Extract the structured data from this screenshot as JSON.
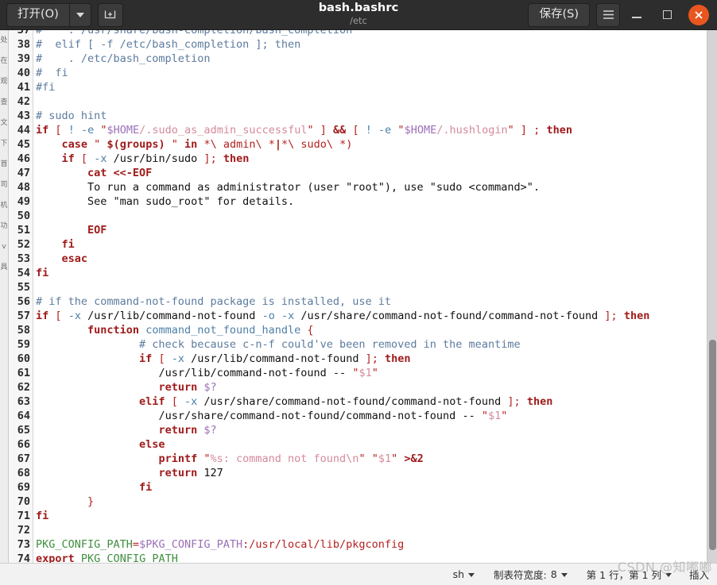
{
  "window": {
    "title": "bash.bashrc",
    "subtitle": "/etc",
    "open_button": "打开(O)",
    "open_dropdown_icon": "chevron-down-icon",
    "new_document_icon": "new-document-icon",
    "save_button": "保存(S)",
    "menu_icon": "hamburger-menu-icon",
    "minimize_icon": "minimize-icon",
    "maximize_icon": "maximize-icon",
    "close_icon": "close-icon",
    "titlebar_bg": "#2d2d2d",
    "close_color": "#e8561f"
  },
  "editor": {
    "first_visible_line": 37,
    "last_visible_line": 74,
    "background_sliver_chars": [
      "处",
      "在",
      "观",
      "查",
      "文",
      "下",
      "首",
      "司",
      "机",
      "功",
      "v",
      "具"
    ],
    "lines": [
      {
        "n": 37,
        "tokens": [
          {
            "t": "#    . /usr/share/bash-completion/bash_completion",
            "c": "c"
          }
        ]
      },
      {
        "n": 38,
        "tokens": [
          {
            "t": "#  elif [ -f /etc/bash_completion ]; then",
            "c": "c"
          }
        ]
      },
      {
        "n": 39,
        "tokens": [
          {
            "t": "#    . /etc/bash_completion",
            "c": "c"
          }
        ]
      },
      {
        "n": 40,
        "tokens": [
          {
            "t": "#  fi",
            "c": "c"
          }
        ]
      },
      {
        "n": 41,
        "tokens": [
          {
            "t": "#fi",
            "c": "c"
          }
        ]
      },
      {
        "n": 42,
        "tokens": []
      },
      {
        "n": 43,
        "tokens": [
          {
            "t": "# sudo hint",
            "c": "c"
          }
        ]
      },
      {
        "n": 44,
        "tokens": [
          {
            "t": "if",
            "c": "kw"
          },
          {
            "t": " ",
            "c": "pl"
          },
          {
            "t": "[",
            "c": "op"
          },
          {
            "t": " ",
            "c": "pl"
          },
          {
            "t": "!",
            "c": "fl"
          },
          {
            "t": " ",
            "c": "pl"
          },
          {
            "t": "-e",
            "c": "fl"
          },
          {
            "t": " ",
            "c": "pl"
          },
          {
            "t": "\"",
            "c": "sq"
          },
          {
            "t": "$HOME",
            "c": "vr"
          },
          {
            "t": "/.sudo_as_admin_successful",
            "c": "st"
          },
          {
            "t": "\"",
            "c": "sq"
          },
          {
            "t": " ",
            "c": "pl"
          },
          {
            "t": "]",
            "c": "op"
          },
          {
            "t": " ",
            "c": "pl"
          },
          {
            "t": "&&",
            "c": "kw"
          },
          {
            "t": " ",
            "c": "pl"
          },
          {
            "t": "[",
            "c": "op"
          },
          {
            "t": " ",
            "c": "pl"
          },
          {
            "t": "!",
            "c": "fl"
          },
          {
            "t": " ",
            "c": "pl"
          },
          {
            "t": "-e",
            "c": "fl"
          },
          {
            "t": " ",
            "c": "pl"
          },
          {
            "t": "\"",
            "c": "sq"
          },
          {
            "t": "$HOME",
            "c": "vr"
          },
          {
            "t": "/.hushlogin",
            "c": "st"
          },
          {
            "t": "\"",
            "c": "sq"
          },
          {
            "t": " ",
            "c": "pl"
          },
          {
            "t": "]",
            "c": "op"
          },
          {
            "t": " ",
            "c": "pl"
          },
          {
            "t": ";",
            "c": "op"
          },
          {
            "t": " ",
            "c": "pl"
          },
          {
            "t": "then",
            "c": "kw"
          }
        ]
      },
      {
        "n": 45,
        "tokens": [
          {
            "t": "    ",
            "c": "pl"
          },
          {
            "t": "case",
            "c": "kw"
          },
          {
            "t": " ",
            "c": "pl"
          },
          {
            "t": "\"",
            "c": "sq"
          },
          {
            "t": " ",
            "c": "st"
          },
          {
            "t": "$(groups)",
            "c": "kw"
          },
          {
            "t": " ",
            "c": "st"
          },
          {
            "t": "\"",
            "c": "sq"
          },
          {
            "t": " ",
            "c": "pl"
          },
          {
            "t": "in",
            "c": "kw"
          },
          {
            "t": " ",
            "c": "pl"
          },
          {
            "t": "*\\ admin\\ *",
            "c": "op"
          },
          {
            "t": "|",
            "c": "kw"
          },
          {
            "t": "*\\ sudo\\ *)",
            "c": "op"
          }
        ]
      },
      {
        "n": 46,
        "tokens": [
          {
            "t": "    ",
            "c": "pl"
          },
          {
            "t": "if",
            "c": "kw"
          },
          {
            "t": " ",
            "c": "pl"
          },
          {
            "t": "[",
            "c": "op"
          },
          {
            "t": " ",
            "c": "pl"
          },
          {
            "t": "-x",
            "c": "fl"
          },
          {
            "t": " ",
            "c": "pl"
          },
          {
            "t": "/usr/bin/sudo",
            "c": "pl"
          },
          {
            "t": " ",
            "c": "pl"
          },
          {
            "t": "]",
            "c": "op"
          },
          {
            "t": ";",
            "c": "op"
          },
          {
            "t": " ",
            "c": "pl"
          },
          {
            "t": "then",
            "c": "kw"
          }
        ]
      },
      {
        "n": 47,
        "tokens": [
          {
            "t": "        ",
            "c": "pl"
          },
          {
            "t": "cat <<-EOF",
            "c": "kw"
          }
        ]
      },
      {
        "n": 48,
        "tokens": [
          {
            "t": "        To run a command as administrator (user \"root\"), use \"sudo <command>\".",
            "c": "pl"
          }
        ]
      },
      {
        "n": 49,
        "tokens": [
          {
            "t": "        See \"man sudo_root\" for details.",
            "c": "pl"
          }
        ]
      },
      {
        "n": 50,
        "tokens": []
      },
      {
        "n": 51,
        "tokens": [
          {
            "t": "        ",
            "c": "pl"
          },
          {
            "t": "EOF",
            "c": "kw"
          }
        ]
      },
      {
        "n": 52,
        "tokens": [
          {
            "t": "    ",
            "c": "pl"
          },
          {
            "t": "fi",
            "c": "kw"
          }
        ]
      },
      {
        "n": 53,
        "tokens": [
          {
            "t": "    ",
            "c": "pl"
          },
          {
            "t": "esac",
            "c": "kw"
          }
        ]
      },
      {
        "n": 54,
        "tokens": [
          {
            "t": "fi",
            "c": "kw"
          }
        ]
      },
      {
        "n": 55,
        "tokens": []
      },
      {
        "n": 56,
        "tokens": [
          {
            "t": "# if the command-not-found package is installed, use it",
            "c": "c"
          }
        ]
      },
      {
        "n": 57,
        "tokens": [
          {
            "t": "if",
            "c": "kw"
          },
          {
            "t": " ",
            "c": "pl"
          },
          {
            "t": "[",
            "c": "op"
          },
          {
            "t": " ",
            "c": "pl"
          },
          {
            "t": "-x",
            "c": "fl"
          },
          {
            "t": " ",
            "c": "pl"
          },
          {
            "t": "/usr/lib/command-not-found",
            "c": "pl"
          },
          {
            "t": " ",
            "c": "pl"
          },
          {
            "t": "-o",
            "c": "fl"
          },
          {
            "t": " ",
            "c": "pl"
          },
          {
            "t": "-x",
            "c": "fl"
          },
          {
            "t": " ",
            "c": "pl"
          },
          {
            "t": "/usr/share/command-not-found/command-not-found",
            "c": "pl"
          },
          {
            "t": " ",
            "c": "pl"
          },
          {
            "t": "]",
            "c": "op"
          },
          {
            "t": ";",
            "c": "op"
          },
          {
            "t": " ",
            "c": "pl"
          },
          {
            "t": "then",
            "c": "kw"
          }
        ]
      },
      {
        "n": 58,
        "tokens": [
          {
            "t": "        ",
            "c": "pl"
          },
          {
            "t": "function",
            "c": "kw"
          },
          {
            "t": " ",
            "c": "pl"
          },
          {
            "t": "command_not_found_handle",
            "c": "fn"
          },
          {
            "t": " ",
            "c": "pl"
          },
          {
            "t": "{",
            "c": "op"
          }
        ]
      },
      {
        "n": 59,
        "tokens": [
          {
            "t": "                ",
            "c": "pl"
          },
          {
            "t": "# check because c-n-f could've been removed in the meantime",
            "c": "c"
          }
        ]
      },
      {
        "n": 60,
        "tokens": [
          {
            "t": "                ",
            "c": "pl"
          },
          {
            "t": "if",
            "c": "kw"
          },
          {
            "t": " ",
            "c": "pl"
          },
          {
            "t": "[",
            "c": "op"
          },
          {
            "t": " ",
            "c": "pl"
          },
          {
            "t": "-x",
            "c": "fl"
          },
          {
            "t": " ",
            "c": "pl"
          },
          {
            "t": "/usr/lib/command-not-found",
            "c": "pl"
          },
          {
            "t": " ",
            "c": "pl"
          },
          {
            "t": "]",
            "c": "op"
          },
          {
            "t": ";",
            "c": "op"
          },
          {
            "t": " ",
            "c": "pl"
          },
          {
            "t": "then",
            "c": "kw"
          }
        ]
      },
      {
        "n": 61,
        "tokens": [
          {
            "t": "                   ",
            "c": "pl"
          },
          {
            "t": "/usr/lib/command-not-found",
            "c": "pl"
          },
          {
            "t": " ",
            "c": "pl"
          },
          {
            "t": "--",
            "c": "pl"
          },
          {
            "t": " ",
            "c": "pl"
          },
          {
            "t": "\"",
            "c": "sq"
          },
          {
            "t": "$1",
            "c": "st"
          },
          {
            "t": "\"",
            "c": "sq"
          }
        ]
      },
      {
        "n": 62,
        "tokens": [
          {
            "t": "                   ",
            "c": "pl"
          },
          {
            "t": "return",
            "c": "kw"
          },
          {
            "t": " ",
            "c": "pl"
          },
          {
            "t": "$?",
            "c": "vr"
          }
        ]
      },
      {
        "n": 63,
        "tokens": [
          {
            "t": "                ",
            "c": "pl"
          },
          {
            "t": "elif",
            "c": "kw"
          },
          {
            "t": " ",
            "c": "pl"
          },
          {
            "t": "[",
            "c": "op"
          },
          {
            "t": " ",
            "c": "pl"
          },
          {
            "t": "-x",
            "c": "fl"
          },
          {
            "t": " ",
            "c": "pl"
          },
          {
            "t": "/usr/share/command-not-found/command-not-found",
            "c": "pl"
          },
          {
            "t": " ",
            "c": "pl"
          },
          {
            "t": "]",
            "c": "op"
          },
          {
            "t": ";",
            "c": "op"
          },
          {
            "t": " ",
            "c": "pl"
          },
          {
            "t": "then",
            "c": "kw"
          }
        ]
      },
      {
        "n": 64,
        "tokens": [
          {
            "t": "                   ",
            "c": "pl"
          },
          {
            "t": "/usr/share/command-not-found/command-not-found",
            "c": "pl"
          },
          {
            "t": " ",
            "c": "pl"
          },
          {
            "t": "--",
            "c": "pl"
          },
          {
            "t": " ",
            "c": "pl"
          },
          {
            "t": "\"",
            "c": "sq"
          },
          {
            "t": "$1",
            "c": "st"
          },
          {
            "t": "\"",
            "c": "sq"
          }
        ]
      },
      {
        "n": 65,
        "tokens": [
          {
            "t": "                   ",
            "c": "pl"
          },
          {
            "t": "return",
            "c": "kw"
          },
          {
            "t": " ",
            "c": "pl"
          },
          {
            "t": "$?",
            "c": "vr"
          }
        ]
      },
      {
        "n": 66,
        "tokens": [
          {
            "t": "                ",
            "c": "pl"
          },
          {
            "t": "else",
            "c": "kw"
          }
        ]
      },
      {
        "n": 67,
        "tokens": [
          {
            "t": "                   ",
            "c": "pl"
          },
          {
            "t": "printf",
            "c": "kw"
          },
          {
            "t": " ",
            "c": "pl"
          },
          {
            "t": "\"",
            "c": "sq"
          },
          {
            "t": "%s: command not found\\n",
            "c": "st"
          },
          {
            "t": "\"",
            "c": "sq"
          },
          {
            "t": " ",
            "c": "pl"
          },
          {
            "t": "\"",
            "c": "sq"
          },
          {
            "t": "$1",
            "c": "st"
          },
          {
            "t": "\"",
            "c": "sq"
          },
          {
            "t": " ",
            "c": "pl"
          },
          {
            "t": ">&2",
            "c": "kw"
          }
        ]
      },
      {
        "n": 68,
        "tokens": [
          {
            "t": "                   ",
            "c": "pl"
          },
          {
            "t": "return",
            "c": "kw"
          },
          {
            "t": " ",
            "c": "pl"
          },
          {
            "t": "127",
            "c": "nm"
          }
        ]
      },
      {
        "n": 69,
        "tokens": [
          {
            "t": "                ",
            "c": "pl"
          },
          {
            "t": "fi",
            "c": "kw"
          }
        ]
      },
      {
        "n": 70,
        "tokens": [
          {
            "t": "        ",
            "c": "pl"
          },
          {
            "t": "}",
            "c": "op"
          }
        ]
      },
      {
        "n": 71,
        "tokens": [
          {
            "t": "fi",
            "c": "kw"
          }
        ]
      },
      {
        "n": 72,
        "tokens": []
      },
      {
        "n": 73,
        "tokens": [
          {
            "t": "PKG_CONFIG_PATH",
            "c": "gn"
          },
          {
            "t": "=",
            "c": "op"
          },
          {
            "t": "$PKG_CONFIG_PATH",
            "c": "vr"
          },
          {
            "t": ":/usr/local/lib/pkgconfig",
            "c": "pt"
          }
        ]
      },
      {
        "n": 74,
        "tokens": [
          {
            "t": "export",
            "c": "kw"
          },
          {
            "t": " ",
            "c": "pl"
          },
          {
            "t": "PKG_CONFIG_PATH",
            "c": "gn"
          }
        ]
      }
    ]
  },
  "statusbar": {
    "language": "sh",
    "tab_width_label": "制表符宽度:",
    "tab_width_value": "8",
    "cursor_position": "第 1 行，第 1 列",
    "insert_mode": "插入",
    "watermark": "CSDN @知嘟嘟"
  }
}
